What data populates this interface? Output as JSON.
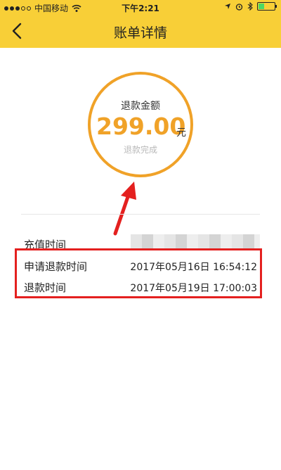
{
  "status_bar": {
    "carrier": "中国移动",
    "time": "下午2:21",
    "battery_color": "#4cd964"
  },
  "nav": {
    "title": "账单详情",
    "back_icon": "chevron-left-icon"
  },
  "refund": {
    "label": "退款金额",
    "amount": "299.00",
    "unit": "元",
    "status": "退款完成",
    "accent_color": "#f0a228"
  },
  "details": [
    {
      "label": "充值时间",
      "value": ""
    },
    {
      "label": "申请退款时间",
      "value": "2017年05月16日  16:54:12"
    },
    {
      "label": "退款时间",
      "value": "2017年05月19日  17:00:03"
    }
  ],
  "theme": {
    "header_color": "#f8cf37",
    "highlight_color": "#e4201f"
  }
}
